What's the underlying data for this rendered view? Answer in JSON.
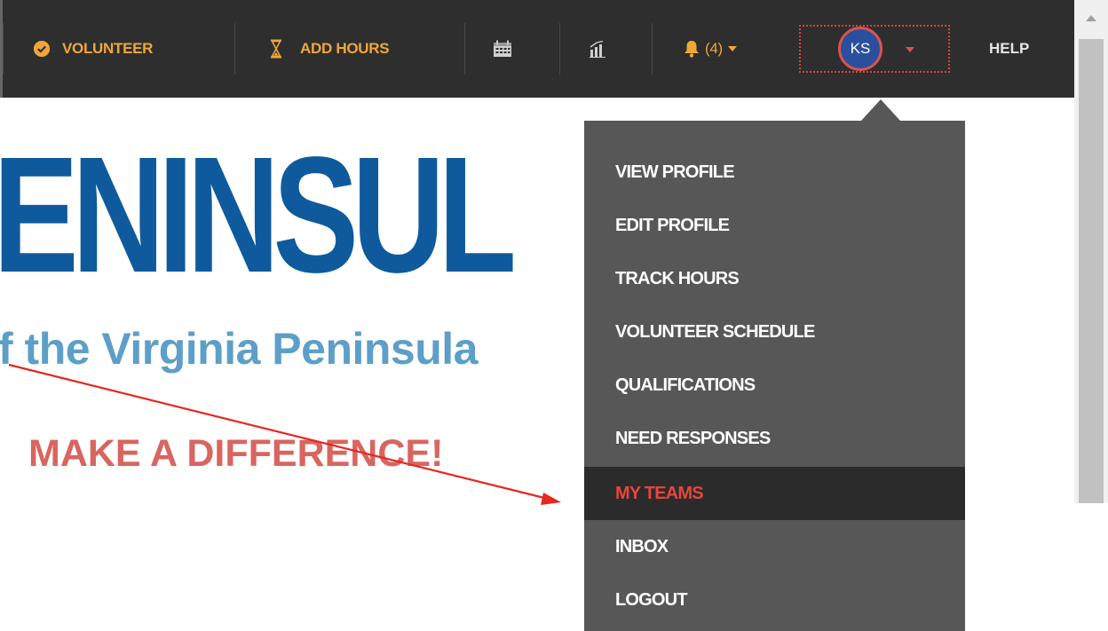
{
  "nav": {
    "volunteer_label": "VOLUNTEER",
    "add_hours_label": "ADD HOURS",
    "notifications_label": "(4)",
    "avatar_initials": "KS",
    "help_label": "HELP"
  },
  "hero": {
    "title": "ENINSUL",
    "subtitle": "f the Virginia Peninsula",
    "tagline": "MAKE A DIFFERENCE!"
  },
  "user_menu": {
    "items": [
      {
        "label": "VIEW PROFILE"
      },
      {
        "label": "EDIT PROFILE"
      },
      {
        "label": "TRACK HOURS"
      },
      {
        "label": "VOLUNTEER SCHEDULE"
      },
      {
        "label": "QUALIFICATIONS"
      },
      {
        "label": "NEED RESPONSES"
      },
      {
        "label": "MY TEAMS",
        "active": true
      },
      {
        "label": "INBOX"
      },
      {
        "label": "LOGOUT"
      }
    ]
  },
  "colors": {
    "nav_bg": "#2e2e2e",
    "nav_accent": "#f0a63a",
    "menu_bg": "#575757",
    "menu_active_bg": "#2b2b2b",
    "menu_active_text": "#e8453c",
    "hero_title": "#0f5a9c",
    "hero_subtitle": "#5d9fc8",
    "hero_tagline": "#d96560",
    "annotation_arrow": "#e8261e",
    "avatar_bg": "#2a4f9c"
  },
  "icons": {
    "volunteer": "check-circle-icon",
    "add_hours": "hourglass-icon",
    "calendar": "calendar-icon",
    "reports": "bar-chart-icon",
    "notifications": "bell-icon",
    "avatar_menu": "caret-down-icon",
    "scroll_up": "scroll-up-arrow-icon"
  }
}
